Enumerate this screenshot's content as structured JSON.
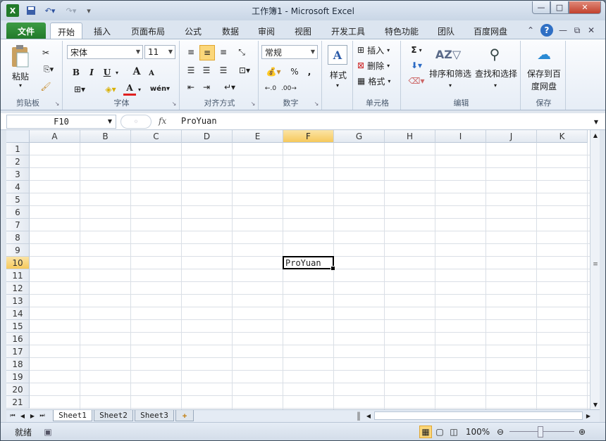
{
  "title_bar": {
    "title": "工作簿1 - Microsoft Excel"
  },
  "tabs": [
    "文件",
    "开始",
    "插入",
    "页面布局",
    "公式",
    "数据",
    "审阅",
    "视图",
    "开发工具",
    "特色功能",
    "团队",
    "百度网盘"
  ],
  "ribbon": {
    "clipboard": {
      "label": "剪贴板",
      "paste": "粘贴"
    },
    "font": {
      "label": "字体",
      "name": "宋体",
      "size": "11",
      "bold": "B",
      "italic": "I",
      "underline": "U",
      "grow": "A",
      "shrink": "A",
      "fontcolor": "A"
    },
    "align": {
      "label": "对齐方式"
    },
    "number": {
      "label": "数字",
      "format": "常规",
      "percent": "%",
      "comma": ","
    },
    "styles": {
      "label": "样式"
    },
    "cells": {
      "label": "单元格",
      "insert": "插入",
      "delete": "删除",
      "format": "格式"
    },
    "editing": {
      "label": "编辑",
      "sum": "Σ",
      "sort": "排序和筛选",
      "find": "查找和选择"
    },
    "save": {
      "label": "保存",
      "action_l1": "保存到百",
      "action_l2": "度网盘"
    }
  },
  "formula_bar": {
    "name_box": "F10",
    "fx": "fx",
    "formula": "ProYuan"
  },
  "grid": {
    "columns": [
      "A",
      "B",
      "C",
      "D",
      "E",
      "F",
      "G",
      "H",
      "I",
      "J",
      "K"
    ],
    "rows": [
      "1",
      "2",
      "3",
      "4",
      "5",
      "6",
      "7",
      "8",
      "9",
      "10",
      "11",
      "12",
      "13",
      "14",
      "15",
      "16",
      "17",
      "18",
      "19",
      "20",
      "21"
    ],
    "selected_col": "F",
    "selected_row": "10",
    "active_cell_value": "ProYuan"
  },
  "sheets": [
    "Sheet1",
    "Sheet2",
    "Sheet3"
  ],
  "status": {
    "ready": "就绪",
    "zoom": "100%"
  },
  "colors": {
    "file_tab": "#2f8a38",
    "selected_header": "#f6c95c"
  }
}
